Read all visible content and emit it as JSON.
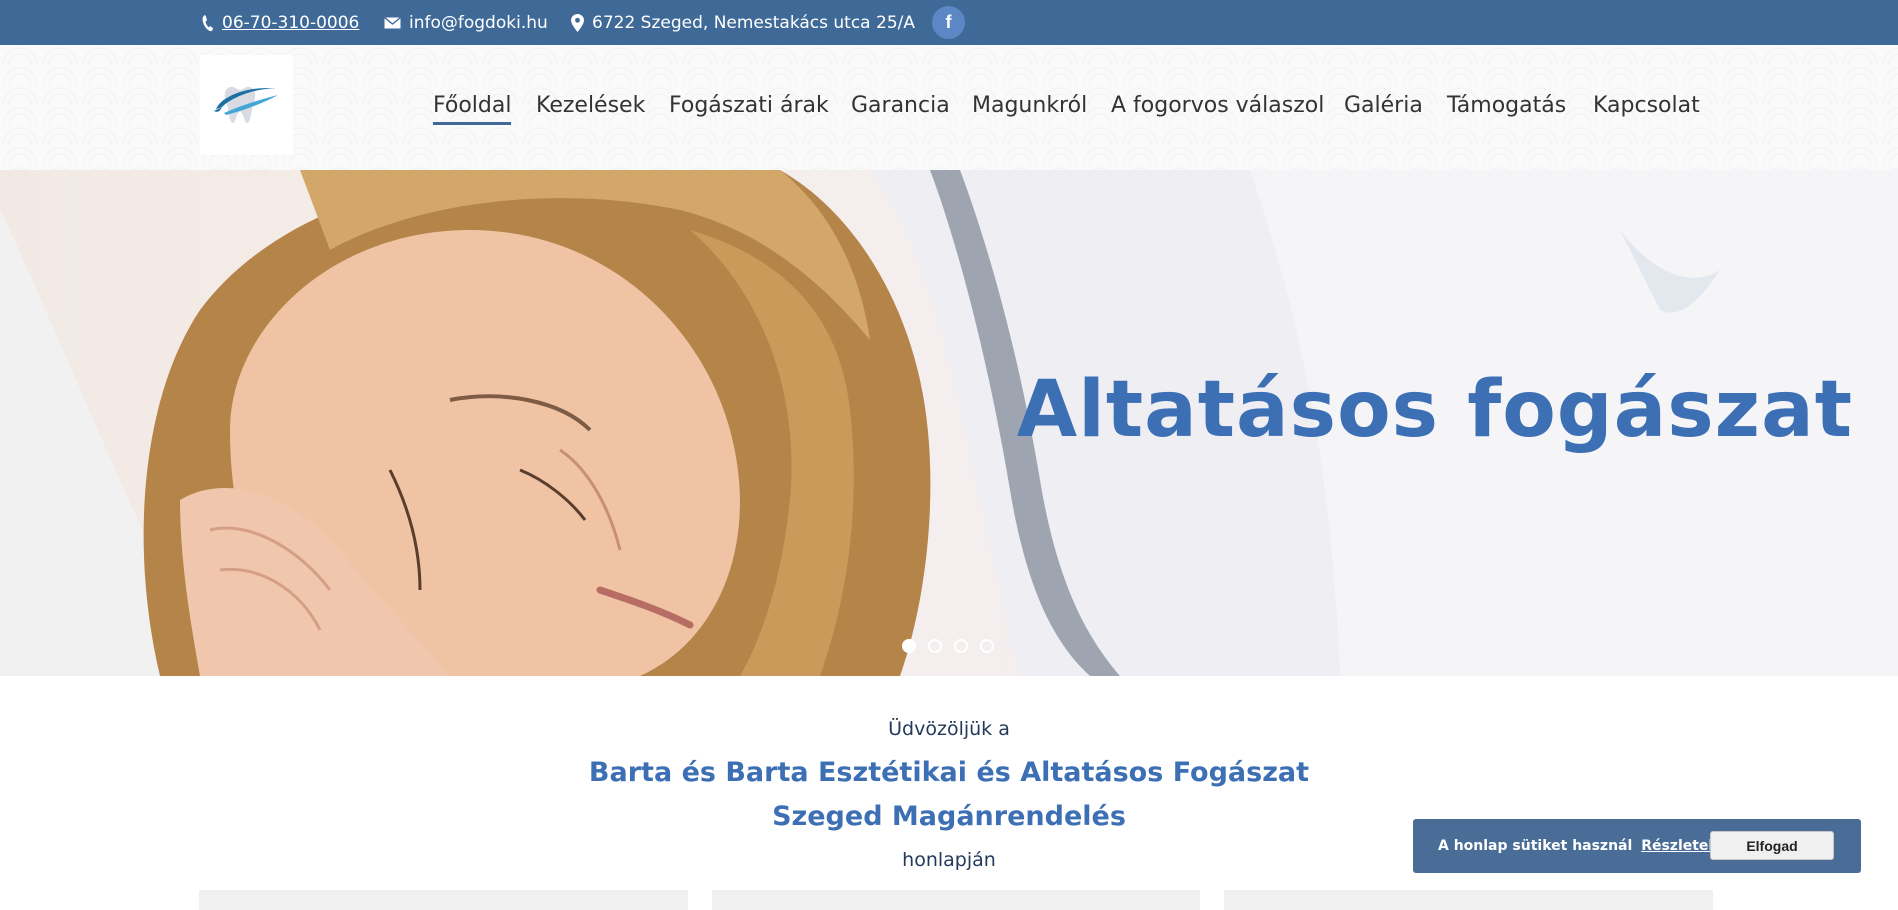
{
  "topbar": {
    "phone": "06-70-310-0006",
    "email": "info@fogdoki.hu",
    "address": "6722 Szeged, Nemestakács utca 25/A",
    "social_icon": "facebook-icon",
    "social_label": "f",
    "bg_color": "#3f6a98"
  },
  "nav": {
    "items": [
      {
        "label": "Főoldal",
        "active": true
      },
      {
        "label": "Kezelések"
      },
      {
        "label": "Fogászati árak"
      },
      {
        "label": "Garancia"
      },
      {
        "label": "Magunkról"
      },
      {
        "label": "A fogorvos válaszol"
      },
      {
        "label": "Galéria"
      },
      {
        "label": "Támogatás"
      },
      {
        "label": "Kapcsolat"
      }
    ]
  },
  "hero": {
    "title": "Altatásos fogászat",
    "slides_count": 4,
    "active_slide": 1,
    "accent_color": "#3c6fb4"
  },
  "intro": {
    "line1": "Üdvözöljük a",
    "line2": "Barta és Barta Esztétikai és Altatásos Fogászat",
    "line3": "Szeged Magánrendelés",
    "line4": "honlapján"
  },
  "cookie": {
    "text": "A honlap sütiket használ",
    "link": "Részletek",
    "button": "Elfogad"
  }
}
